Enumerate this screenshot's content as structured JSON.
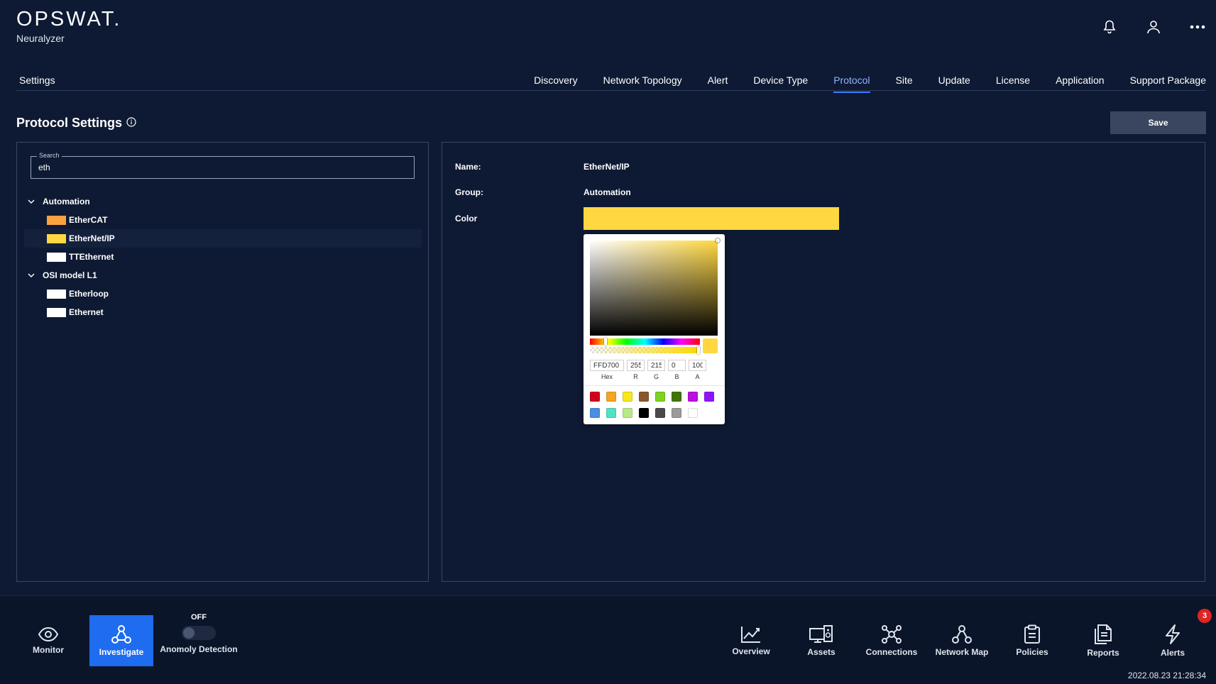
{
  "header": {
    "logo": "OPSWAT.",
    "product": "Neuralyzer"
  },
  "tabs_bar": {
    "settings_label": "Settings",
    "tabs": [
      {
        "label": "Discovery"
      },
      {
        "label": "Network Topology"
      },
      {
        "label": "Alert"
      },
      {
        "label": "Device Type"
      },
      {
        "label": "Protocol",
        "active": true
      },
      {
        "label": "Site"
      },
      {
        "label": "Update"
      },
      {
        "label": "License"
      },
      {
        "label": "Application"
      },
      {
        "label": "Support Package"
      }
    ]
  },
  "page": {
    "title": "Protocol Settings",
    "save_label": "Save"
  },
  "search": {
    "legend": "Search",
    "value": "eth"
  },
  "tree": {
    "groups": [
      {
        "label": "Automation",
        "items": [
          {
            "label": "EtherCAT",
            "color": "#ffa040"
          },
          {
            "label": "EtherNet/IP",
            "color": "#ffd740",
            "selected": true
          },
          {
            "label": "TTEthernet",
            "color": "#ffffff"
          }
        ]
      },
      {
        "label": "OSI model L1",
        "items": [
          {
            "label": "Etherloop",
            "color": "#ffffff"
          },
          {
            "label": "Ethernet",
            "color": "#ffffff"
          }
        ]
      }
    ]
  },
  "details": {
    "name_label": "Name:",
    "name_value": "EtherNet/IP",
    "group_label": "Group:",
    "group_value": "Automation",
    "color_label": "Color",
    "color_value": "#ffd740"
  },
  "picker": {
    "hex": "FFD700",
    "r": "255",
    "g": "215",
    "b": "0",
    "a": "100",
    "labels": {
      "hex": "Hex",
      "r": "R",
      "g": "G",
      "b": "B",
      "a": "A"
    },
    "current_color": "#ffd740",
    "hue_fraction": 0.14,
    "alpha_fraction": 1.0,
    "presets": [
      "#d0021b",
      "#f5a623",
      "#f8e71c",
      "#8b572a",
      "#7ed321",
      "#417505",
      "#bd10e0",
      "#9013fe",
      "#4a90e2",
      "#50e3c2",
      "#b8e986",
      "#000000",
      "#4a4a4a",
      "#9b9b9b",
      "#ffffff"
    ]
  },
  "bottom": {
    "monitor": "Monitor",
    "investigate": "Investigate",
    "toggle_state": "OFF",
    "toggle_label": "Anomoly Detection",
    "nav": [
      {
        "label": "Overview",
        "icon": "chart-line-icon"
      },
      {
        "label": "Assets",
        "icon": "devices-icon"
      },
      {
        "label": "Connections",
        "icon": "connections-icon"
      },
      {
        "label": "Network Map",
        "icon": "network-map-icon"
      },
      {
        "label": "Policies",
        "icon": "clipboard-icon"
      },
      {
        "label": "Reports",
        "icon": "reports-icon"
      },
      {
        "label": "Alerts",
        "icon": "lightning-icon"
      }
    ],
    "alerts_badge": "3",
    "timestamp": "2022.08.23 21:28:34"
  }
}
